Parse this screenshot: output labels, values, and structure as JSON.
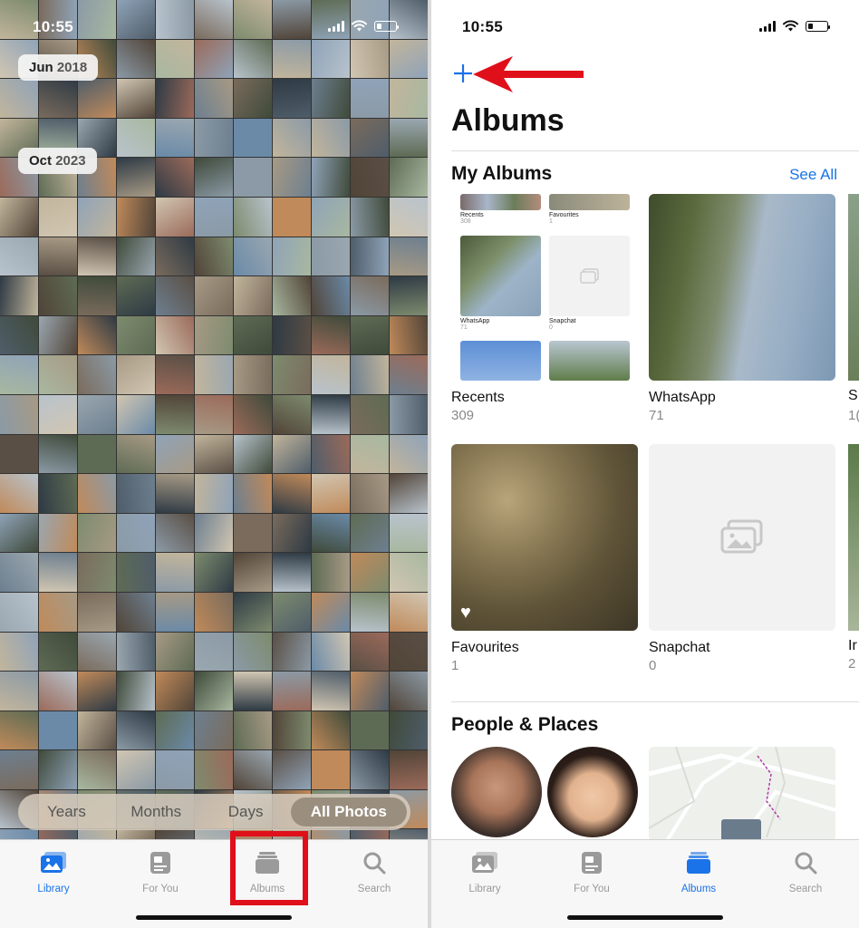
{
  "left": {
    "status": {
      "time": "10:55"
    },
    "date_labels": [
      {
        "month": "Jun",
        "year": "2018"
      },
      {
        "month": "Oct",
        "year": "2023"
      }
    ],
    "view_switcher": {
      "items": [
        "Years",
        "Months",
        "Days",
        "All Photos"
      ],
      "selected": "All Photos"
    }
  },
  "right": {
    "status": {
      "time": "10:55"
    },
    "title": "Albums",
    "my_albums": {
      "title": "My Albums",
      "see_all": "See All",
      "albums": [
        {
          "name": "Recents",
          "count": "309"
        },
        {
          "name": "WhatsApp",
          "count": "71"
        },
        {
          "name": "Favourites",
          "count": "1"
        },
        {
          "name": "Snapchat",
          "count": "0"
        }
      ],
      "mini": [
        {
          "name": "Recents",
          "count": "308"
        },
        {
          "name": "Favourites",
          "count": "1"
        },
        {
          "name": "WhatsApp",
          "count": "71"
        },
        {
          "name": "Snapchat",
          "count": "0"
        }
      ],
      "edge_labels": [
        {
          "name": "S",
          "count": "1("
        },
        {
          "name": "Ir",
          "count": "2"
        }
      ]
    },
    "people_places": {
      "title": "People & Places"
    }
  },
  "tabs": [
    {
      "label": "Library",
      "icon": "photo-library-icon"
    },
    {
      "label": "For You",
      "icon": "for-you-icon"
    },
    {
      "label": "Albums",
      "icon": "albums-icon"
    },
    {
      "label": "Search",
      "icon": "search-icon"
    }
  ],
  "left_active_tab": "Library",
  "right_active_tab": "Albums",
  "colors": {
    "accent": "#1a73e8",
    "highlight_red": "#e0101b",
    "inactive_tab": "#999999"
  }
}
